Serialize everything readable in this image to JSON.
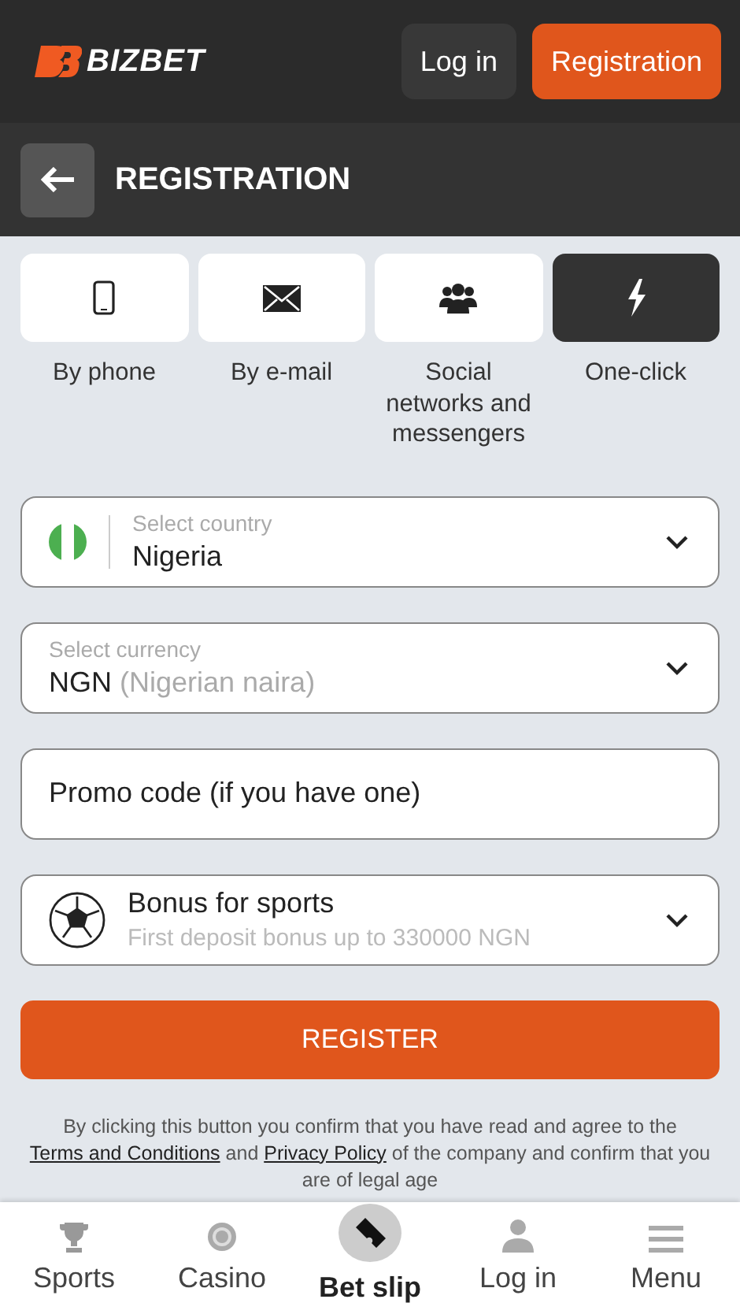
{
  "header": {
    "logo": "BIZBET",
    "buttons": [
      {
        "label": "Log in",
        "kind": "secondary"
      },
      {
        "label": "Registration",
        "kind": "primary"
      }
    ]
  },
  "page": {
    "title": "REGISTRATION"
  },
  "methods": [
    {
      "label": "By phone",
      "kind": "phone",
      "selected": false
    },
    {
      "label": "By e-mail",
      "kind": "email",
      "selected": false
    },
    {
      "label": "Social networks and messengers",
      "kind": "social",
      "selected": false
    },
    {
      "label": "One-click",
      "kind": "oneclick",
      "selected": true
    }
  ],
  "fields": [
    {
      "kind": "country",
      "label": "Select country",
      "value": "Nigeria"
    },
    {
      "kind": "currency",
      "label": "Select currency",
      "value": "NGN",
      "note": "(Nigerian naira)"
    },
    {
      "kind": "promo",
      "placeholder": "Promo code (if you have one)"
    },
    {
      "kind": "bonus",
      "value": "Bonus for sports",
      "note": "First deposit bonus up to 330000 NGN"
    }
  ],
  "register_button": "REGISTER",
  "legal": {
    "before": "By clicking this button you confirm that you have read and agree to the ",
    "link_1": "Terms and Conditions",
    "middle": " and ",
    "link_2": "Privacy Policy",
    "after": " of the company and confirm that you are of legal age"
  },
  "nav": [
    {
      "label": "Sports",
      "kind": "sports",
      "selected": false
    },
    {
      "label": "Casino",
      "kind": "casino",
      "selected": false
    },
    {
      "label": "Bet slip",
      "kind": "betslip",
      "selected": true
    },
    {
      "label": "Log in",
      "kind": "login",
      "selected": false
    },
    {
      "label": "Menu",
      "kind": "menu",
      "selected": false
    }
  ]
}
